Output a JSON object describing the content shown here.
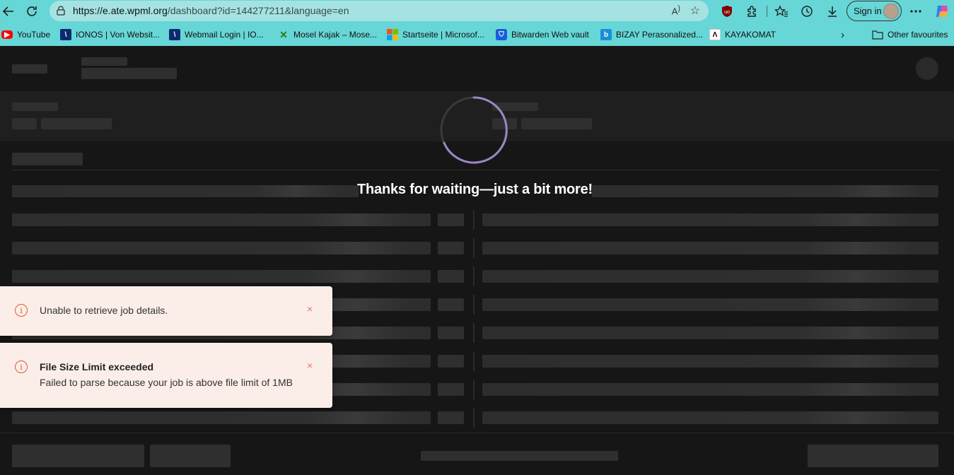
{
  "browser": {
    "url_host": "https://e.ate.wpml.org",
    "url_rest": "/dashboard?id=144277211&language=en",
    "sign_in_label": "Sign in",
    "bookmarks": [
      {
        "label": "YouTube",
        "icon": "youtube-icon",
        "color": "#ff0000"
      },
      {
        "label": "IONOS | Von Websit...",
        "icon": "ionos-icon",
        "color": "#0b2a6f"
      },
      {
        "label": "Webmail Login | IO...",
        "icon": "ionos-icon",
        "color": "#0b2a6f"
      },
      {
        "label": "Mosel Kajak – Mose...",
        "icon": "kayak-icon",
        "color": "#3a8a2a"
      },
      {
        "label": "Startseite | Microsof...",
        "icon": "microsoft-icon",
        "color": "#f25022"
      },
      {
        "label": "Bitwarden Web vault",
        "icon": "bitwarden-icon",
        "color": "#175ddc"
      },
      {
        "label": "BIZAY Perasonalized...",
        "icon": "bizay-icon",
        "color": "#1a8fd8"
      },
      {
        "label": "KAYAKOMAT",
        "icon": "kayakomat-icon",
        "color": "#ffffff"
      }
    ],
    "other_favourites_label": "Other favourites"
  },
  "loader": {
    "message": "Thanks for waiting—just a bit more!",
    "spinner_color": "#9b86c4"
  },
  "toasts": [
    {
      "title": "",
      "message": "Unable to retrieve job details.",
      "close": "×"
    },
    {
      "title": "File Size Limit exceeded",
      "message": "Failed to parse because your job is above file limit of 1MB",
      "close": "×"
    }
  ],
  "colors": {
    "chrome": "#67d6d6",
    "toast_bg": "#fbeee9",
    "error_accent": "#e05a2b"
  }
}
